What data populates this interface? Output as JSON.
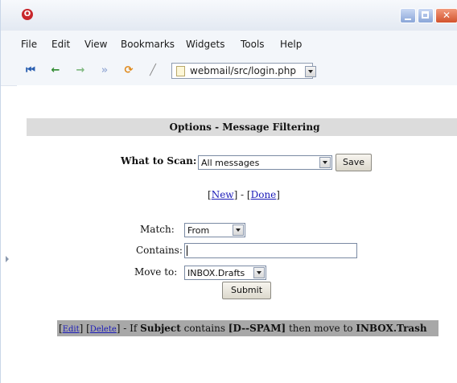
{
  "browser": {
    "menu": [
      "File",
      "Edit",
      "View",
      "Bookmarks",
      "Widgets",
      "Tools",
      "Help"
    ],
    "address": "webmail/src/login.php"
  },
  "page": {
    "title": "Options - Message Filtering",
    "scan": {
      "label": "What to Scan:",
      "value": "All messages",
      "save_label": "Save"
    },
    "links": {
      "open_new": "[",
      "new": "New",
      "sep": "] - [",
      "done": "Done",
      "close": "]"
    },
    "form": {
      "match_label": "Match:",
      "match_value": "From",
      "contains_label": "Contains:",
      "contains_value": "",
      "move_label": "Move to:",
      "move_value": "INBOX.Drafts",
      "submit_label": "Submit"
    },
    "rule": {
      "edit": "Edit",
      "delete": "Delete",
      "t1": " - If ",
      "field": "Subject",
      "t2": " contains ",
      "pattern": "[D--SPAM]",
      "t3": " then move to ",
      "folder": "INBOX.Trash"
    }
  },
  "colors": {
    "title_bar_bg": "#dcdcdc",
    "rule_bar_bg": "#a8a8a8",
    "link": "#1a1ab8",
    "close_button": "#d2532d"
  }
}
